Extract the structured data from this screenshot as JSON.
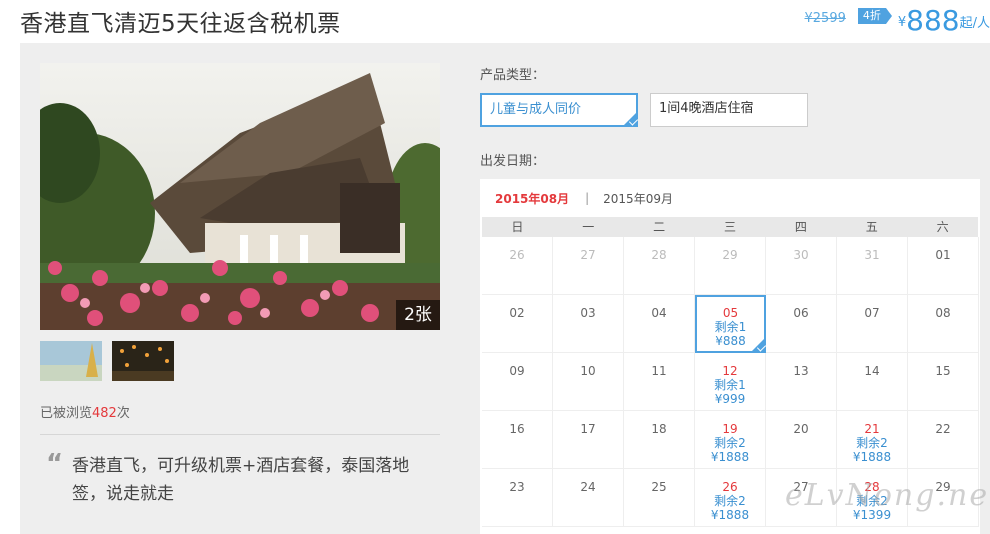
{
  "header": {
    "title": "香港直飞清迈5天往返含税机票",
    "old_price": "¥2599",
    "discount": "4折",
    "currency": "¥",
    "price": "888",
    "per": "起/人"
  },
  "gallery": {
    "photo_count": "2张",
    "views_prefix": "已被浏览",
    "views_count": "482",
    "views_suffix": "次"
  },
  "description": {
    "quote_mark": "“",
    "text": "香港直飞，可升级机票+酒店套餐，泰国落地签，说走就走"
  },
  "product_type": {
    "label": "产品类型：",
    "options": [
      {
        "label": "儿童与成人同价",
        "selected": true
      },
      {
        "label": "1间4晚酒店住宿",
        "selected": false
      }
    ]
  },
  "departure": {
    "label": "出发日期："
  },
  "calendar": {
    "months": [
      {
        "label": "2015年08月",
        "active": true
      },
      {
        "label": "2015年09月",
        "active": false
      }
    ],
    "month_separator": "|",
    "weekdays": [
      "日",
      "一",
      "二",
      "三",
      "四",
      "五",
      "六"
    ],
    "weeks": [
      [
        {
          "day": "26",
          "prev": true
        },
        {
          "day": "27",
          "prev": true
        },
        {
          "day": "28",
          "prev": true
        },
        {
          "day": "29",
          "prev": true
        },
        {
          "day": "30",
          "prev": true
        },
        {
          "day": "31",
          "prev": true
        },
        {
          "day": "01"
        }
      ],
      [
        {
          "day": "02"
        },
        {
          "day": "03"
        },
        {
          "day": "04"
        },
        {
          "day": "05",
          "stock": "剩余1",
          "price": "¥888",
          "selected": true
        },
        {
          "day": "06"
        },
        {
          "day": "07"
        },
        {
          "day": "08"
        }
      ],
      [
        {
          "day": "09"
        },
        {
          "day": "10"
        },
        {
          "day": "11"
        },
        {
          "day": "12",
          "stock": "剩余1",
          "price": "¥999"
        },
        {
          "day": "13"
        },
        {
          "day": "14"
        },
        {
          "day": "15"
        }
      ],
      [
        {
          "day": "16"
        },
        {
          "day": "17"
        },
        {
          "day": "18"
        },
        {
          "day": "19",
          "stock": "剩余2",
          "price": "¥1888"
        },
        {
          "day": "20"
        },
        {
          "day": "21",
          "stock": "剩余2",
          "price": "¥1888"
        },
        {
          "day": "22"
        }
      ],
      [
        {
          "day": "23"
        },
        {
          "day": "24"
        },
        {
          "day": "25"
        },
        {
          "day": "26",
          "stock": "剩余2",
          "price": "¥1888"
        },
        {
          "day": "27"
        },
        {
          "day": "28",
          "stock": "剩余2",
          "price": "¥1399"
        },
        {
          "day": "29"
        }
      ]
    ]
  },
  "watermark": "eLvNong.net",
  "colors": {
    "accent": "#4fa2e0",
    "red": "#e4393c",
    "panel": "#eeeeee"
  }
}
